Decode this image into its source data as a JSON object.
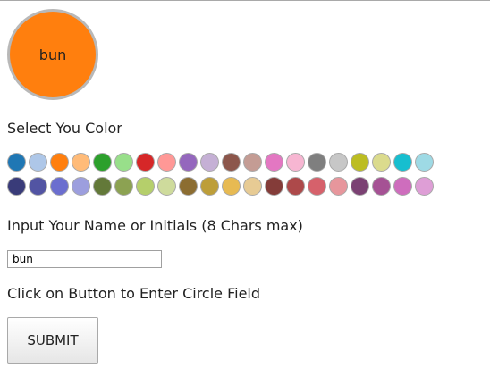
{
  "avatar": {
    "text": "bun",
    "color": "#ff7f0e"
  },
  "color_section": {
    "label": "Select You Color",
    "palette_row_1": [
      "#1f77b4",
      "#aec7e8",
      "#ff7f0e",
      "#ffbb78",
      "#2ca02c",
      "#98df8a",
      "#d62728",
      "#ff9896",
      "#9467bd",
      "#c5b0d5",
      "#8c564b",
      "#c49c94",
      "#e377c2",
      "#f7b6d2",
      "#7f7f7f",
      "#c7c7c7",
      "#bcbd22",
      "#dbdb8d",
      "#17becf",
      "#9edae5"
    ],
    "palette_row_2": [
      "#393b79",
      "#5254a3",
      "#6b6ecf",
      "#9c9ede",
      "#637939",
      "#8ca252",
      "#b5cf6b",
      "#cedb9c",
      "#8c6d31",
      "#bd9e39",
      "#e7ba52",
      "#e7cb94",
      "#843c39",
      "#ad494a",
      "#d6616b",
      "#e7969c",
      "#7b4173",
      "#a55194",
      "#ce6dbd",
      "#de9ed6"
    ]
  },
  "name_section": {
    "label": "Input Your Name or Initials (8 Chars max)",
    "input_value": "bun"
  },
  "submit_section": {
    "label": "Click on Button to Enter Circle Field",
    "button_label": "SUBMIT"
  }
}
